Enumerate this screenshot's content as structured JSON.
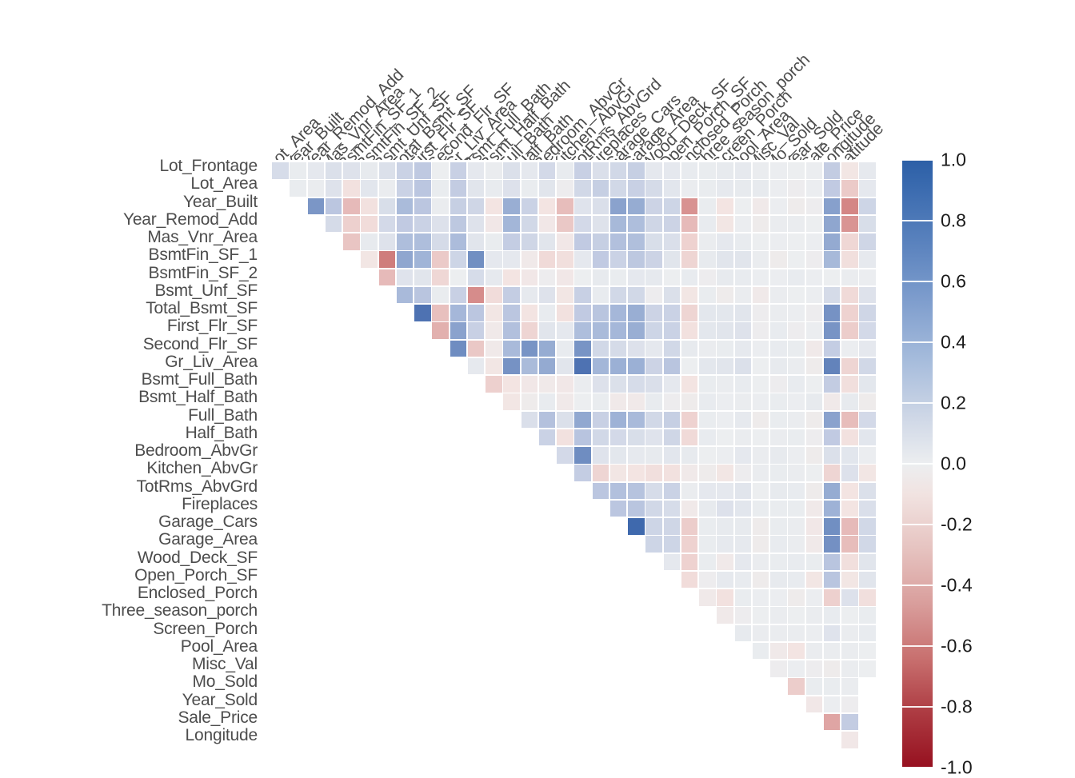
{
  "chart_data": {
    "type": "heatmap",
    "title": "",
    "xlabel": "",
    "ylabel": "",
    "subtitle": "",
    "grid": false,
    "triangular": "upper",
    "colormap": "RdBu diverging (blue positive, red negative)",
    "colorbar": {
      "position": "right",
      "vmin": -1.0,
      "vmax": 1.0,
      "ticks": [
        "1.0",
        "0.8",
        "0.6",
        "0.4",
        "0.2",
        "0.0",
        "-0.2",
        "-0.4",
        "-0.6",
        "-0.8",
        "-1.0"
      ],
      "tick_values": [
        1.0,
        0.8,
        0.6,
        0.4,
        0.2,
        0.0,
        -0.2,
        -0.4,
        -0.6,
        -0.8,
        -1.0
      ],
      "color_max": "#2c5fa6",
      "color_mid": "#eceef0",
      "color_min": "#96101f"
    },
    "ylim": [
      -1.0,
      1.0
    ],
    "row_labels": [
      "Lot_Frontage",
      "Lot_Area",
      "Year_Built",
      "Year_Remod_Add",
      "Mas_Vnr_Area",
      "BsmtFin_SF_1",
      "BsmtFin_SF_2",
      "Bsmt_Unf_SF",
      "Total_Bsmt_SF",
      "First_Flr_SF",
      "Second_Flr_SF",
      "Gr_Liv_Area",
      "Bsmt_Full_Bath",
      "Bsmt_Half_Bath",
      "Full_Bath",
      "Half_Bath",
      "Bedroom_AbvGr",
      "Kitchen_AbvGr",
      "TotRms_AbvGrd",
      "Fireplaces",
      "Garage_Cars",
      "Garage_Area",
      "Wood_Deck_SF",
      "Open_Porch_SF",
      "Enclosed_Porch",
      "Three_season_porch",
      "Screen_Porch",
      "Pool_Area",
      "Misc_Val",
      "Mo_Sold",
      "Year_Sold",
      "Sale_Price",
      "Longitude"
    ],
    "column_labels": [
      "Lot_Area",
      "Year_Built",
      "Year_Remod_Add",
      "Mas_Vnr_Area",
      "BsmtFin_SF_1",
      "BsmtFin_SF_2",
      "Bsmt_Unf_SF",
      "Total_Bsmt_SF",
      "First_Flr_SF",
      "Second_Flr_SF",
      "Gr_Liv_Area",
      "Bsmt_Full_Bath",
      "Bsmt_Half_Bath",
      "Full_Bath",
      "Half_Bath",
      "Bedroom_AbvGr",
      "Kitchen_AbvGr",
      "TotRms_AbvGrd",
      "Fireplaces",
      "Garage_Cars",
      "Garage_Area",
      "Wood_Deck_SF",
      "Open_Porch_SF",
      "Enclosed_Porch",
      "Three_season_porch",
      "Screen_Porch",
      "Pool_Area",
      "Misc_Val",
      "Mo_Sold",
      "Year_Sold",
      "Sale_Price",
      "Longitude",
      "Latitude"
    ],
    "values": [
      [
        0.17,
        0.03,
        0.07,
        0.14,
        0.12,
        0.05,
        0.14,
        0.24,
        0.3,
        0.0,
        0.25,
        0.07,
        0.02,
        0.14,
        0.07,
        0.19,
        0.04,
        0.25,
        0.15,
        0.2,
        0.26,
        0.07,
        0.07,
        0.04,
        0.03,
        0.05,
        0.06,
        0.02,
        0.01,
        0.0,
        0.01,
        0.28,
        -0.05,
        0.06
      ],
      [
        null,
        0.03,
        0.02,
        0.12,
        -0.07,
        0.09,
        0.02,
        0.24,
        0.32,
        0.03,
        0.28,
        0.1,
        0.04,
        0.13,
        0.03,
        0.1,
        -0.01,
        0.2,
        0.26,
        0.2,
        0.25,
        0.18,
        0.09,
        0.02,
        0.03,
        0.06,
        0.05,
        0.05,
        0.01,
        -0.01,
        0.01,
        0.29,
        -0.16,
        0.07
      ],
      [
        null,
        null,
        0.61,
        0.32,
        -0.22,
        -0.07,
        0.16,
        0.41,
        0.32,
        0.02,
        0.26,
        0.21,
        -0.06,
        0.49,
        0.24,
        -0.06,
        -0.21,
        0.11,
        0.15,
        0.55,
        0.5,
        0.23,
        0.22,
        -0.39,
        0.03,
        -0.06,
        0.0,
        -0.03,
        0.01,
        -0.02,
        -0.01,
        0.56,
        -0.45,
        0.22
      ],
      [
        null,
        null,
        null,
        0.18,
        -0.14,
        -0.09,
        0.19,
        0.29,
        0.24,
        0.13,
        0.31,
        0.12,
        -0.04,
        0.45,
        0.2,
        -0.04,
        -0.17,
        0.19,
        0.12,
        0.43,
        0.39,
        0.21,
        0.23,
        -0.22,
        0.04,
        -0.05,
        0.01,
        -0.02,
        0.02,
        0.02,
        0.0,
        0.53,
        -0.38,
        0.16
      ],
      [
        null,
        null,
        null,
        null,
        -0.18,
        0.05,
        0.12,
        0.39,
        0.39,
        0.18,
        0.4,
        0.1,
        0.03,
        0.27,
        0.21,
        0.1,
        -0.04,
        0.29,
        0.26,
        0.37,
        0.38,
        0.16,
        0.15,
        -0.13,
        0.02,
        0.07,
        0.04,
        0.0,
        0.01,
        0.0,
        0.01,
        0.51,
        -0.11,
        0.21
      ],
      [
        null,
        null,
        null,
        null,
        null,
        -0.05,
        -0.51,
        0.53,
        0.46,
        -0.16,
        0.22,
        0.65,
        0.07,
        0.07,
        -0.03,
        -0.1,
        -0.08,
        0.07,
        0.29,
        0.24,
        0.31,
        0.23,
        0.1,
        -0.12,
        0.05,
        0.1,
        0.1,
        0.02,
        -0.02,
        0.0,
        -0.01,
        0.43,
        -0.08,
        0.06
      ],
      [
        null,
        null,
        null,
        null,
        null,
        null,
        -0.22,
        0.11,
        0.1,
        -0.11,
        0.0,
        0.17,
        0.06,
        -0.06,
        -0.04,
        -0.01,
        -0.04,
        0.0,
        0.05,
        0.03,
        0.07,
        0.06,
        0.0,
        0.04,
        -0.01,
        0.05,
        0.04,
        0.01,
        0.01,
        0.04,
        0.01,
        0.0,
        0.02,
        0.01
      ],
      [
        null,
        null,
        null,
        null,
        null,
        null,
        null,
        0.42,
        0.33,
        0.03,
        0.25,
        -0.42,
        -0.09,
        0.27,
        0.06,
        0.12,
        -0.05,
        0.25,
        0.04,
        0.2,
        0.2,
        -0.01,
        0.14,
        -0.05,
        0.03,
        -0.02,
        0.02,
        -0.03,
        0.02,
        0.0,
        0.01,
        0.18,
        -0.1,
        0.12
      ],
      [
        null,
        null,
        null,
        null,
        null,
        null,
        null,
        null,
        0.8,
        -0.2,
        0.44,
        0.32,
        -0.05,
        0.32,
        -0.06,
        0.04,
        -0.07,
        0.29,
        0.33,
        0.44,
        0.49,
        0.23,
        0.24,
        -0.12,
        0.08,
        0.08,
        0.1,
        -0.01,
        0.02,
        0.01,
        -0.01,
        0.63,
        -0.13,
        0.21
      ],
      [
        null,
        null,
        null,
        null,
        null,
        null,
        null,
        null,
        null,
        -0.26,
        0.55,
        0.25,
        -0.03,
        0.37,
        -0.12,
        0.1,
        0.07,
        0.39,
        0.41,
        0.44,
        0.49,
        0.22,
        0.24,
        -0.07,
        0.08,
        0.1,
        0.12,
        -0.01,
        0.04,
        -0.01,
        0.01,
        0.62,
        -0.15,
        0.19
      ],
      [
        null,
        null,
        null,
        null,
        null,
        null,
        null,
        null,
        null,
        null,
        0.66,
        -0.17,
        -0.03,
        0.42,
        0.62,
        0.5,
        0.04,
        0.62,
        0.2,
        0.18,
        0.13,
        0.07,
        0.2,
        0.05,
        0.02,
        0.03,
        0.06,
        0.01,
        0.04,
        0.03,
        -0.03,
        0.27,
        0.01,
        0.07
      ],
      [
        null,
        null,
        null,
        null,
        null,
        null,
        null,
        null,
        null,
        null,
        null,
        0.06,
        -0.05,
        0.63,
        0.41,
        0.51,
        0.1,
        0.8,
        0.45,
        0.48,
        0.48,
        0.23,
        0.33,
        0.0,
        0.08,
        0.1,
        0.14,
        0.0,
        0.05,
        0.02,
        -0.02,
        0.71,
        -0.12,
        0.2
      ],
      [
        null,
        null,
        null,
        null,
        null,
        null,
        null,
        null,
        null,
        null,
        null,
        null,
        -0.14,
        -0.06,
        -0.04,
        -0.03,
        -0.04,
        0.02,
        0.13,
        0.14,
        0.17,
        0.15,
        0.07,
        -0.06,
        0.03,
        0.02,
        0.04,
        0.0,
        -0.01,
        0.04,
        0.0,
        0.28,
        -0.08,
        0.08
      ],
      [
        null,
        null,
        null,
        null,
        null,
        null,
        null,
        null,
        null,
        null,
        null,
        null,
        null,
        -0.05,
        -0.02,
        0.04,
        -0.03,
        0.0,
        0.03,
        -0.03,
        -0.03,
        0.04,
        -0.01,
        -0.02,
        0.04,
        0.01,
        0.02,
        0.01,
        0.03,
        0.01,
        0.05,
        -0.03,
        0.05,
        -0.02
      ],
      [
        null,
        null,
        null,
        null,
        null,
        null,
        null,
        null,
        null,
        null,
        null,
        null,
        null,
        null,
        0.15,
        0.36,
        0.14,
        0.52,
        0.25,
        0.47,
        0.42,
        0.2,
        0.26,
        -0.13,
        0.03,
        0.01,
        0.06,
        -0.02,
        0.03,
        0.02,
        -0.02,
        0.55,
        -0.21,
        0.19
      ],
      [
        null,
        null,
        null,
        null,
        null,
        null,
        null,
        null,
        null,
        null,
        null,
        null,
        null,
        null,
        null,
        0.24,
        -0.07,
        0.34,
        0.2,
        0.19,
        0.16,
        0.11,
        0.21,
        -0.1,
        0.04,
        0.0,
        0.02,
        0.0,
        0.02,
        0.03,
        -0.01,
        0.29,
        -0.07,
        0.09
      ],
      [
        null,
        null,
        null,
        null,
        null,
        null,
        null,
        null,
        null,
        null,
        null,
        null,
        null,
        null,
        null,
        null,
        0.19,
        0.66,
        0.11,
        0.08,
        0.06,
        0.05,
        0.09,
        0.05,
        0.0,
        0.01,
        0.07,
        0.02,
        0.05,
        0.01,
        -0.02,
        0.14,
        0.09,
        0.01
      ],
      [
        null,
        null,
        null,
        null,
        null,
        null,
        null,
        null,
        null,
        null,
        null,
        null,
        null,
        null,
        null,
        null,
        null,
        0.27,
        -0.12,
        -0.05,
        -0.06,
        -0.08,
        -0.07,
        -0.03,
        -0.02,
        -0.05,
        -0.01,
        0.02,
        0.03,
        0.02,
        0.0,
        -0.12,
        0.13,
        -0.05
      ],
      [
        null,
        null,
        null,
        null,
        null,
        null,
        null,
        null,
        null,
        null,
        null,
        null,
        null,
        null,
        null,
        null,
        null,
        null,
        0.32,
        0.37,
        0.35,
        0.17,
        0.24,
        0.02,
        0.07,
        0.07,
        0.1,
        0.0,
        0.05,
        0.04,
        -0.02,
        0.5,
        -0.06,
        0.14
      ],
      [
        null,
        null,
        null,
        null,
        null,
        null,
        null,
        null,
        null,
        null,
        null,
        null,
        null,
        null,
        null,
        null,
        null,
        null,
        null,
        0.32,
        0.33,
        0.2,
        0.17,
        -0.03,
        0.05,
        0.13,
        0.09,
        0.03,
        0.03,
        0.03,
        -0.03,
        0.47,
        -0.06,
        0.15
      ],
      [
        null,
        null,
        null,
        null,
        null,
        null,
        null,
        null,
        null,
        null,
        null,
        null,
        null,
        null,
        null,
        null,
        null,
        null,
        null,
        null,
        0.89,
        0.22,
        0.21,
        -0.15,
        0.03,
        0.05,
        0.05,
        -0.02,
        0.03,
        0.02,
        -0.04,
        0.65,
        -0.22,
        0.2
      ],
      [
        null,
        null,
        null,
        null,
        null,
        null,
        null,
        null,
        null,
        null,
        null,
        null,
        null,
        null,
        null,
        null,
        null,
        null,
        null,
        null,
        null,
        0.22,
        0.22,
        -0.13,
        0.03,
        0.06,
        0.06,
        -0.02,
        0.04,
        0.02,
        -0.03,
        0.64,
        -0.21,
        0.2
      ],
      [
        null,
        null,
        null,
        null,
        null,
        null,
        null,
        null,
        null,
        null,
        null,
        null,
        null,
        null,
        null,
        null,
        null,
        null,
        null,
        null,
        null,
        null,
        0.07,
        -0.13,
        0.03,
        -0.03,
        0.07,
        0.02,
        0.03,
        0.04,
        0.03,
        0.33,
        -0.08,
        0.1
      ],
      [
        null,
        null,
        null,
        null,
        null,
        null,
        null,
        null,
        null,
        null,
        null,
        null,
        null,
        null,
        null,
        null,
        null,
        null,
        null,
        null,
        null,
        null,
        null,
        -0.09,
        -0.01,
        0.06,
        0.04,
        -0.02,
        0.05,
        0.04,
        -0.05,
        0.33,
        -0.05,
        0.1
      ],
      [
        null,
        null,
        null,
        null,
        null,
        null,
        null,
        null,
        null,
        null,
        null,
        null,
        null,
        null,
        null,
        null,
        null,
        null,
        null,
        null,
        null,
        null,
        null,
        null,
        -0.03,
        -0.07,
        0.03,
        0.01,
        0.01,
        -0.02,
        0.01,
        -0.14,
        0.13,
        -0.08
      ],
      [
        null,
        null,
        null,
        null,
        null,
        null,
        null,
        null,
        null,
        null,
        null,
        null,
        null,
        null,
        null,
        null,
        null,
        null,
        null,
        null,
        null,
        null,
        null,
        null,
        null,
        -0.03,
        -0.01,
        0.0,
        0.02,
        0.0,
        0.02,
        0.04,
        0.0,
        0.03
      ],
      [
        null,
        null,
        null,
        null,
        null,
        null,
        null,
        null,
        null,
        null,
        null,
        null,
        null,
        null,
        null,
        null,
        null,
        null,
        null,
        null,
        null,
        null,
        null,
        null,
        null,
        null,
        0.05,
        0.02,
        0.02,
        0.02,
        0.01,
        0.11,
        0.02,
        0.04
      ],
      [
        null,
        null,
        null,
        null,
        null,
        null,
        null,
        null,
        null,
        null,
        null,
        null,
        null,
        null,
        null,
        null,
        null,
        null,
        null,
        null,
        null,
        null,
        null,
        null,
        null,
        null,
        null,
        0.03,
        -0.03,
        -0.06,
        0.02,
        0.02,
        0.02,
        0.0
      ],
      [
        null,
        null,
        null,
        null,
        null,
        null,
        null,
        null,
        null,
        null,
        null,
        null,
        null,
        null,
        null,
        null,
        null,
        null,
        null,
        null,
        null,
        null,
        null,
        null,
        null,
        null,
        null,
        null,
        -0.01,
        0.01,
        -0.01,
        -0.02,
        0.02,
        0.0
      ],
      [
        null,
        null,
        null,
        null,
        null,
        null,
        null,
        null,
        null,
        null,
        null,
        null,
        null,
        null,
        null,
        null,
        null,
        null,
        null,
        null,
        null,
        null,
        null,
        null,
        null,
        null,
        null,
        null,
        null,
        -0.15,
        0.03,
        0.03,
        0.02
      ],
      [
        null,
        null,
        null,
        null,
        null,
        null,
        null,
        null,
        null,
        null,
        null,
        null,
        null,
        null,
        null,
        null,
        null,
        null,
        null,
        null,
        null,
        null,
        null,
        null,
        null,
        null,
        null,
        null,
        null,
        null,
        -0.04,
        0.01,
        -0.01
      ],
      [
        null,
        null,
        null,
        null,
        null,
        null,
        null,
        null,
        null,
        null,
        null,
        null,
        null,
        null,
        null,
        null,
        null,
        null,
        null,
        null,
        null,
        null,
        null,
        null,
        null,
        null,
        null,
        null,
        null,
        null,
        null,
        -0.3,
        0.28
      ],
      [
        null,
        null,
        null,
        null,
        null,
        null,
        null,
        null,
        null,
        null,
        null,
        null,
        null,
        null,
        null,
        null,
        null,
        null,
        null,
        null,
        null,
        null,
        null,
        null,
        null,
        null,
        null,
        null,
        null,
        null,
        null,
        null,
        -0.04
      ]
    ]
  }
}
